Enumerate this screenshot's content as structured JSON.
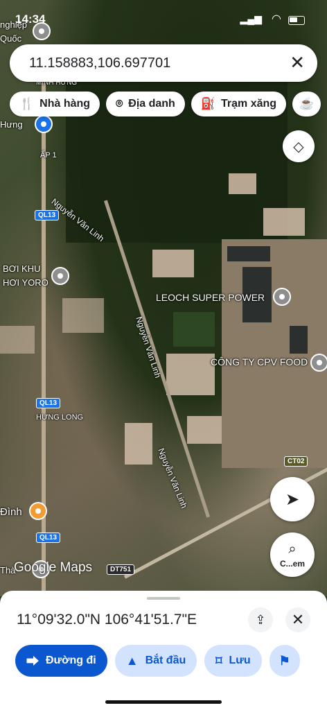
{
  "status_bar": {
    "time": "14:34"
  },
  "search": {
    "query": "11.158883,106.697701",
    "clear_icon": "close-icon"
  },
  "chips": [
    {
      "label": "Nhà hàng",
      "icon": "restaurant-icon"
    },
    {
      "label": "Địa danh",
      "icon": "landmark-icon"
    },
    {
      "label": "Trạm xăng",
      "icon": "gas-station-icon"
    },
    {
      "label": "",
      "icon": "coffee-icon"
    }
  ],
  "map": {
    "labels": {
      "nghiep": "nghiệp",
      "quoc": "Quốc",
      "minh_hung": "MINH HƯNG",
      "hung": "Hưng",
      "ap1": "ẤP 1",
      "nvl1": "Nguyễn Văn Linh",
      "nvl2": "Nguyễn Văn Linh",
      "nvl3": "Nguyễn Văn Linh",
      "boi_khu": "BƠI KHU",
      "hoi_yoro": "HƠI YORO",
      "leoch": "LEOCH SUPER POWER",
      "cpv": "CÔNG TY CPV FOOD",
      "hung_long": "HƯNG LONG",
      "dinh": "Đình",
      "tha": "Thà"
    },
    "shields": {
      "ql13a": "QL13",
      "ql13b": "QL13",
      "ql13c": "QL13",
      "ct02": "CT02",
      "dt751": "DT751"
    },
    "attribution": "Google Maps"
  },
  "fabs": {
    "lens_label": "C...em"
  },
  "sheet": {
    "coordinates": "11°09'32.0\"N 106°41'51.7\"E",
    "actions": [
      {
        "label": "Đường đi",
        "icon": "directions-icon"
      },
      {
        "label": "Bắt đầu",
        "icon": "navigation-icon"
      },
      {
        "label": "Lưu",
        "icon": "bookmark-icon"
      },
      {
        "label": "",
        "icon": "flag-icon"
      }
    ]
  }
}
